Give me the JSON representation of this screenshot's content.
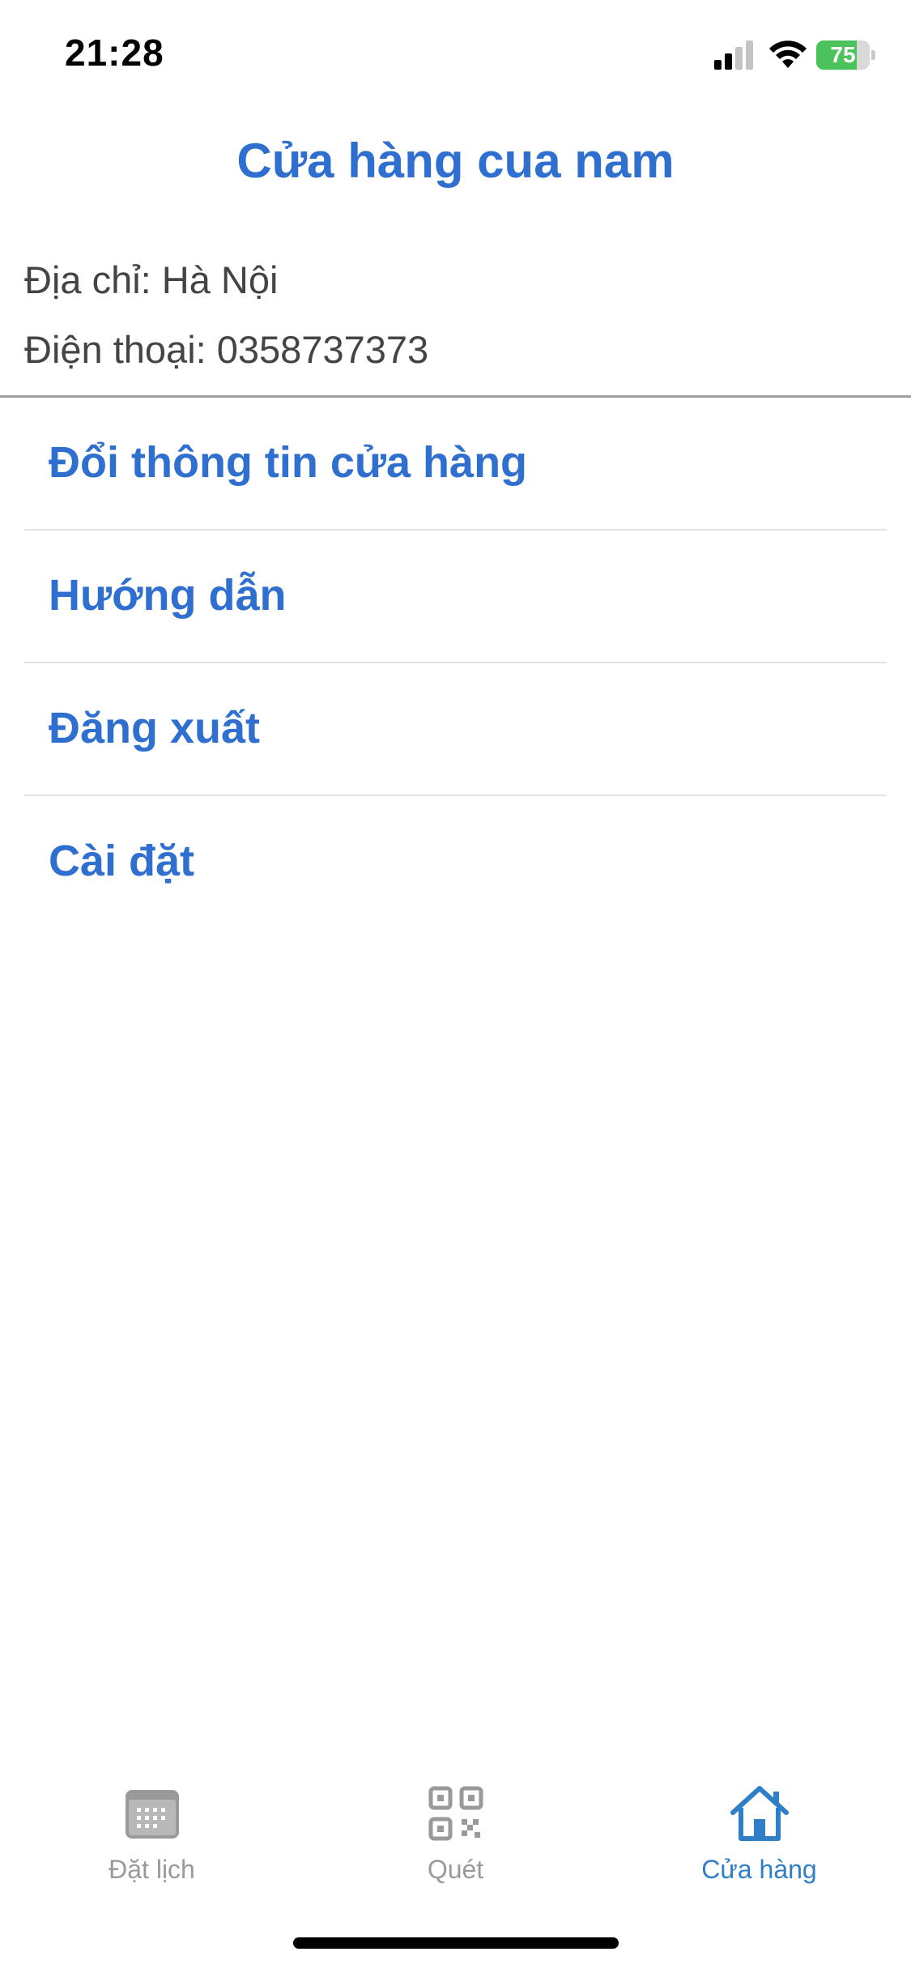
{
  "status_bar": {
    "time": "21:28",
    "battery_level": "75",
    "battery_fraction": 0.75,
    "signal_icon": "cellular-signal-icon",
    "wifi_icon": "wifi-icon",
    "battery_icon": "battery-charging-icon"
  },
  "header": {
    "title": "Cửa hàng cua nam"
  },
  "store_info": {
    "address": "Địa chỉ: Hà Nội",
    "phone": "Điện thoại: 0358737373"
  },
  "menu": {
    "items": [
      {
        "label": "Đổi thông tin cửa hàng"
      },
      {
        "label": "Hướng dẫn"
      },
      {
        "label": "Đăng xuất"
      },
      {
        "label": "Cài đặt"
      }
    ]
  },
  "tab_bar": {
    "tabs": [
      {
        "label": "Đặt lịch",
        "icon": "calendar-icon",
        "active": false
      },
      {
        "label": "Quét",
        "icon": "qr-code-icon",
        "active": false
      },
      {
        "label": "Cửa hàng",
        "icon": "home-icon",
        "active": true
      }
    ]
  },
  "colors": {
    "accent": "#2f6fd0",
    "tab_active": "#2f7fc8",
    "tab_inactive": "#9a9a9a",
    "text_secondary": "#444444",
    "battery_green": "#4cc35a"
  }
}
